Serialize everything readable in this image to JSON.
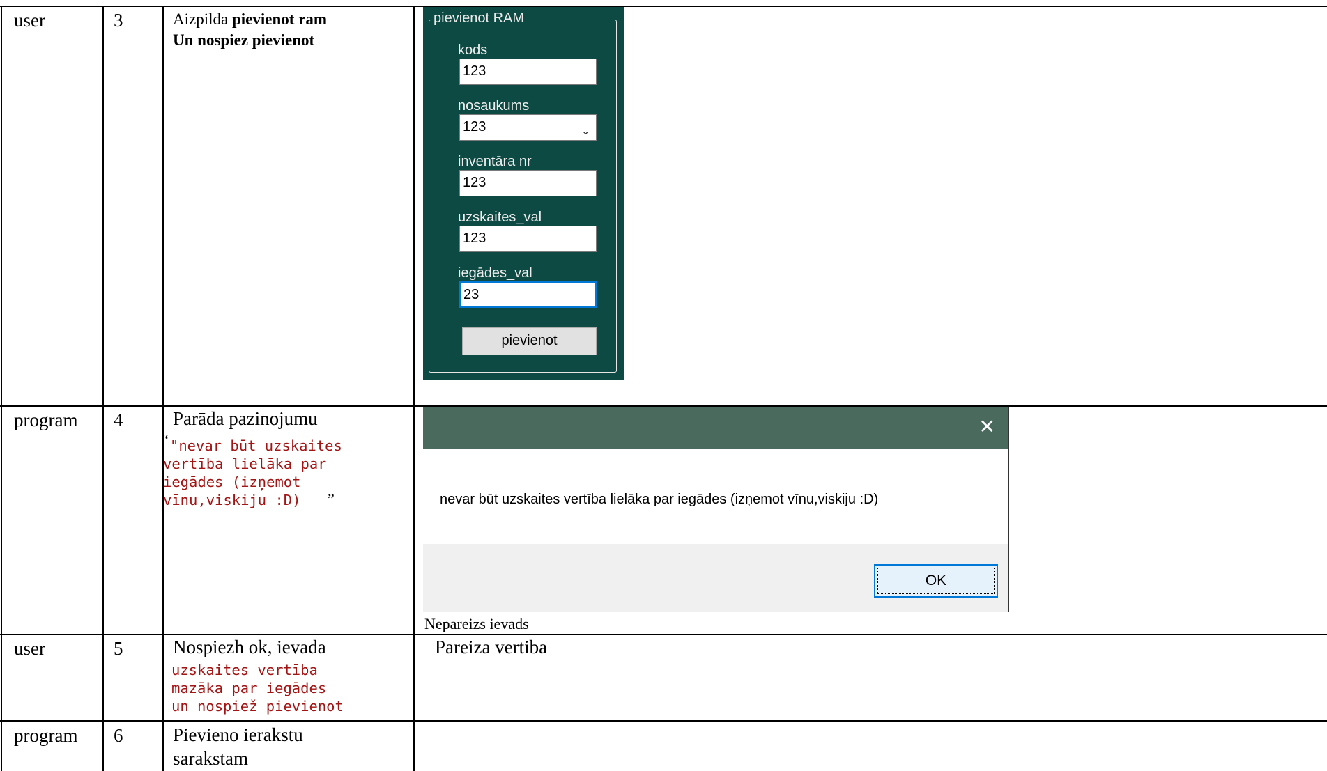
{
  "rows": [
    {
      "actor": "user",
      "step": "3",
      "desc_prefix": "Aizpilda ",
      "desc_bold_1": "pievienot ram",
      "desc_bold_2": "Un nospiez pievienot",
      "form": {
        "legend": "pievienot RAM",
        "fields": [
          {
            "label": "kods",
            "value": "123"
          },
          {
            "label": "nosaukums",
            "value": "123"
          },
          {
            "label": "inventāra nr",
            "value": "123"
          },
          {
            "label": "uzskaites_val",
            "value": "123"
          },
          {
            "label": "iegādes_val",
            "value": "23"
          }
        ],
        "button": "pievienot",
        "dropdown_icon": "chevron-down-icon"
      }
    },
    {
      "actor": "program",
      "step": "4",
      "desc": "Parāda pazinojumu",
      "quote_open": "“",
      "quote_close": "”",
      "code_lines": [
        "\"nevar būt uzskaites",
        "vertība lielāka par",
        "iegādes (izņemot",
        "vīnu,viskiju :D)"
      ],
      "dialog": {
        "close_icon": "close-icon",
        "message": "nevar būt uzskaites vertība lielāka par iegādes (izņemot vīnu,viskiju :D)",
        "ok_label": "OK"
      },
      "caption": "Nepareizs ievads"
    },
    {
      "actor": "user",
      "step": "5",
      "desc": "Nospiezh ok, ievada",
      "code_lines": [
        "uzskaites vertība",
        "mazāka par iegādes",
        "un nospiež pievienot"
      ],
      "result": "Pareiza vertiba"
    },
    {
      "actor": "program",
      "step": "6",
      "desc_line1": "Pievieno ierakstu",
      "desc_line2": "sarakstam"
    }
  ],
  "colors": {
    "form_bg": "#0d4a44",
    "dialog_title": "#4a6a5e",
    "code_text": "#a31515"
  }
}
